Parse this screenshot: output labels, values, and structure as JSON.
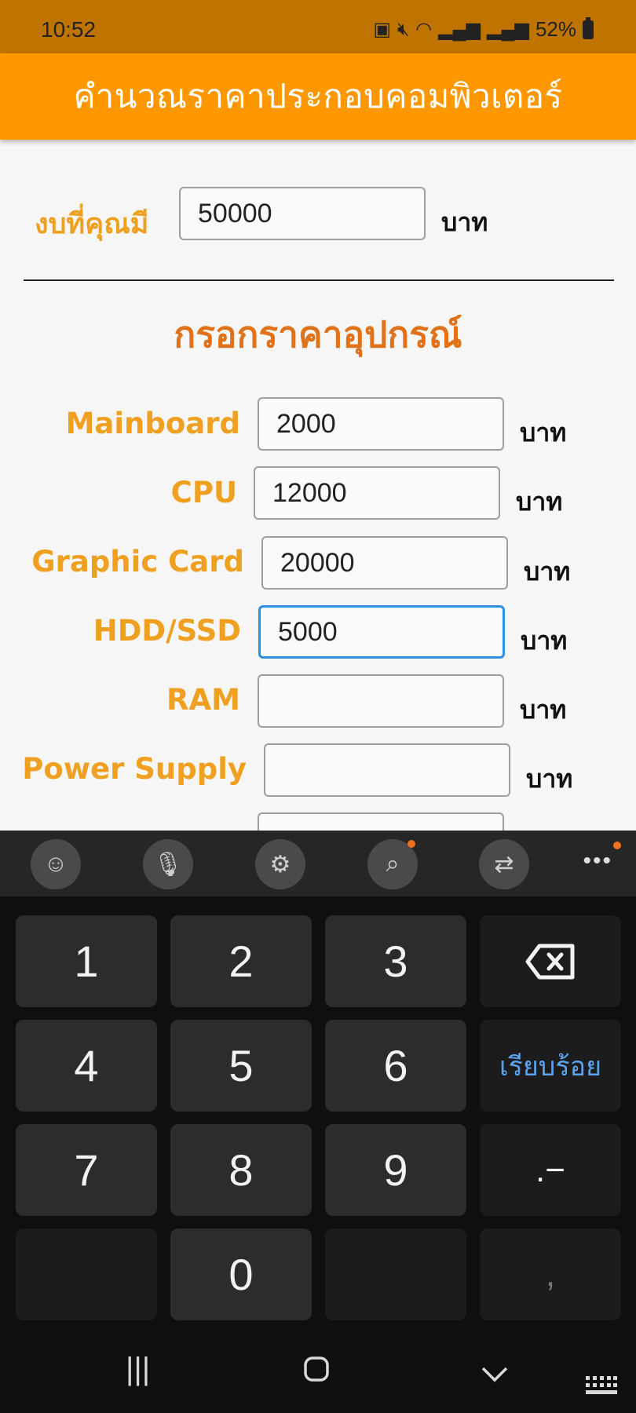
{
  "status_bar": {
    "time": "10:52",
    "battery": "52%"
  },
  "app": {
    "title": "คำนวณราคาประกอบคอมพิวเตอร์"
  },
  "budget": {
    "label": "งบที่คุณมี",
    "value": "50000",
    "unit": "บาท"
  },
  "section_title": "กรอกราคาอุปกรณ์",
  "components": [
    {
      "label": "Mainboard",
      "value": "2000",
      "unit": "บาท"
    },
    {
      "label": "CPU",
      "value": "12000",
      "unit": "บาท"
    },
    {
      "label": "Graphic Card",
      "value": "20000",
      "unit": "บาท"
    },
    {
      "label": "HDD/SSD",
      "value": "5000",
      "unit": "บาท"
    },
    {
      "label": "RAM",
      "value": "",
      "unit": "บาท"
    },
    {
      "label": "Power Supply",
      "value": "",
      "unit": "บาท"
    }
  ],
  "keyboard": {
    "keys": [
      "1",
      "2",
      "3",
      "4",
      "5",
      "6",
      "7",
      "8",
      "9",
      "0"
    ],
    "done_label": "เรียบร้อย",
    "symbol_key": ".−",
    "comma_key": ","
  },
  "colors": {
    "app_bar": "#ff9800",
    "status_bar": "#c07400",
    "label": "#f0a020",
    "section_title": "#e0731a",
    "focus_border": "#2f8fe0"
  }
}
